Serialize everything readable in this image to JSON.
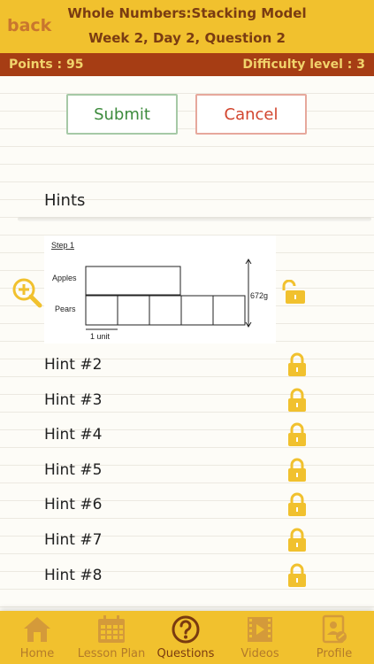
{
  "header": {
    "back_label": "back",
    "title": "Whole Numbers:Stacking Model",
    "subtitle": "Week 2, Day 2, Question 2"
  },
  "stats": {
    "points": "Points : 95",
    "difficulty": "Difficulty level : 3"
  },
  "actions": {
    "submit": "Submit",
    "cancel": "Cancel"
  },
  "hints": {
    "title": "Hints",
    "step_card": {
      "step": "Step 1",
      "apples": "Apples",
      "pears": "Pears",
      "total": "672g",
      "unit": "1 unit"
    },
    "locked": [
      "Hint #2",
      "Hint #3",
      "Hint #4",
      "Hint #5",
      "Hint #6",
      "Hint #7",
      "Hint #8"
    ]
  },
  "tabs": [
    {
      "label": "Home",
      "icon": "home-icon"
    },
    {
      "label": "Lesson Plan",
      "icon": "calendar-icon"
    },
    {
      "label": "Questions",
      "icon": "question-icon"
    },
    {
      "label": "Videos",
      "icon": "film-icon"
    },
    {
      "label": "Profile",
      "icon": "profile-icon"
    }
  ],
  "colors": {
    "header": "#f1c12e",
    "stat_bar": "#a63d14",
    "lock": "#f1c12e",
    "submit": "#3d8b3d",
    "cancel": "#d2452e"
  }
}
